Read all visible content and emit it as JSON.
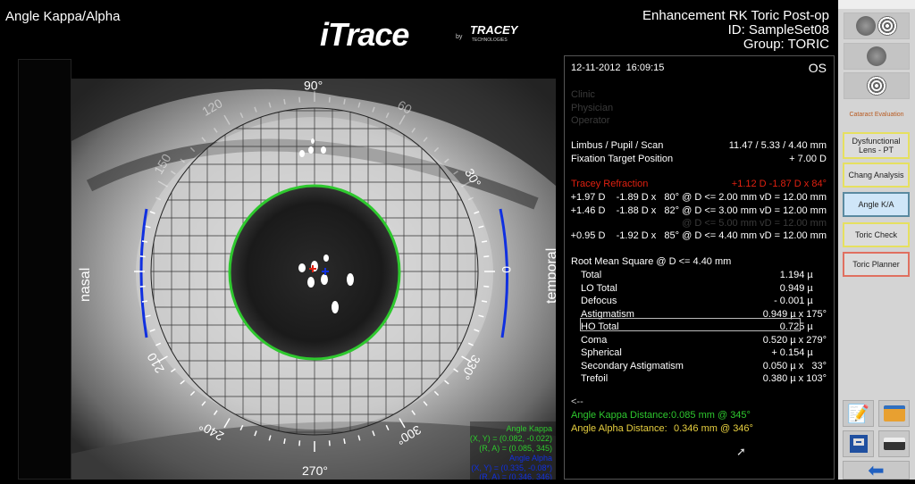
{
  "header": {
    "title": "Angle Kappa/Alpha",
    "logo_main": "iTrace",
    "logo_by": "by",
    "logo_brand": "TRACEY",
    "logo_sub": "TECHNOLOGIES",
    "exam": "Enhancement RK Toric Post-op",
    "id": "ID:  SampleSet08",
    "group": "Group:  TORIC"
  },
  "image": {
    "deg_90": "90°",
    "deg_270": "270°",
    "deg_0": "0",
    "deg_30": "30°",
    "deg_330": "330°",
    "deg_300": "300°",
    "deg_240": "240°",
    "deg_210": "210",
    "deg_60": "60",
    "deg_120": "120",
    "deg_150": "150",
    "nasal": "nasal",
    "temporal": "temporal",
    "kappa_title": "Angle Kappa",
    "kappa_xy": "(X, Y) = (0.082, -0.022)",
    "kappa_ra": "(R, A) = (0.085, 345)",
    "alpha_title": "Angle Alpha",
    "alpha_xy": "(X, Y) = (0.335, -0.08*)",
    "alpha_ra": "(R, A) = (0.346, 346)",
    "colors": {
      "pupil": "#2ec82e",
      "limbus_arc": "#1030e0"
    }
  },
  "panel": {
    "datetime": "12-11-2012  16:09:15",
    "eye": "OS",
    "clinic": "Clinic",
    "physician": "Physician",
    "operator": "Operator",
    "lps_label": "Limbus / Pupil / Scan",
    "lps_value": "11.47 / 5.33 / 4.40 mm",
    "fix_label": "Fixation Target Position",
    "fix_value": "+ 7.00 D",
    "refraction_label": "Tracey Refraction",
    "refraction_value": "+1.12 D -1.87 D x 84°",
    "ref_rows": [
      "+1.97 D    -1.89 D x   80° @ D <= 2.00 mm vD = 12.00 mm",
      "+1.46 D    -1.88 D x   82° @ D <= 3.00 mm vD = 12.00 mm",
      "@ D <= 5.00 mm vD = 12.00 mm",
      "+0.95 D    -1.92 D x   85° @ D <= 4.40 mm vD = 12.00 mm"
    ],
    "rms_title": "Root Mean Square @ D <= 4.40 mm",
    "rms": [
      {
        "label": "Total",
        "value": "1.194 µ     "
      },
      {
        "label": "LO Total",
        "value": "0.949 µ     "
      },
      {
        "label": "Defocus",
        "value": "- 0.001 µ     "
      },
      {
        "label": "Astigmatism",
        "value": "0.949 µ x 175°"
      },
      {
        "label": "HO Total",
        "value": "0.725 µ     "
      },
      {
        "label": "Coma",
        "value": "0.520 µ x 279°"
      },
      {
        "label": "Spherical",
        "value": "+ 0.154 µ     "
      },
      {
        "label": "Secondary Astigmatism",
        "value": "0.050 µ x   33°"
      },
      {
        "label": "Trefoil",
        "value": "0.380 µ x 103°"
      }
    ],
    "back": "<--",
    "kappa_label": "Angle Kappa Distance:",
    "kappa_value": "0.085 mm @ 345°",
    "alpha_label": "Angle Alpha Distance:",
    "alpha_value": "0.346 mm @ 346°"
  },
  "sidebar": {
    "section": "Cataract Evaluation",
    "buttons": [
      "Dysfunctional Lens - PT",
      "Chang Analysis",
      "Angle K/A",
      "Toric Check",
      "Toric Planner"
    ],
    "active": "Angle K/A"
  }
}
